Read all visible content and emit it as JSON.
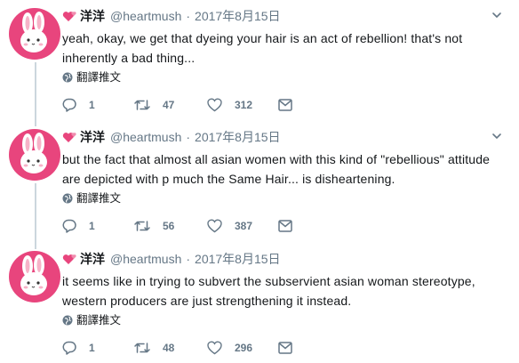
{
  "colors": {
    "avatar_bg": "#e8457d",
    "text": "#14171a",
    "secondary": "#657786",
    "thread_line": "#ccd6dd"
  },
  "icons": {
    "name_emoji": "two-hearts-icon",
    "menu": "chevron-down-icon",
    "translate": "globe-icon",
    "reply": "reply-icon",
    "retweet": "retweet-icon",
    "like": "heart-icon",
    "dm": "envelope-icon"
  },
  "tweets": [
    {
      "display_name": "洋洋",
      "handle": "@heartmush",
      "separator": "·",
      "date": "2017年8月15日",
      "text": "yeah, okay, we get that dyeing your hair is an act of rebellion! that's not inherently a bad thing...",
      "translate_label": "翻譯推文",
      "replies": "1",
      "retweets": "47",
      "likes": "312"
    },
    {
      "display_name": "洋洋",
      "handle": "@heartmush",
      "separator": "·",
      "date": "2017年8月15日",
      "text": "but the fact that almost all asian women with this kind of \"rebellious\" attitude are depicted with p much the Same Hair... is disheartening.",
      "translate_label": "翻譯推文",
      "replies": "1",
      "retweets": "56",
      "likes": "387"
    },
    {
      "display_name": "洋洋",
      "handle": "@heartmush",
      "separator": "·",
      "date": "2017年8月15日",
      "text": "it seems like in trying to subvert the subservient asian woman stereotype, western producers are just strengthening it instead.",
      "translate_label": "翻譯推文",
      "replies": "1",
      "retweets": "48",
      "likes": "296"
    }
  ]
}
